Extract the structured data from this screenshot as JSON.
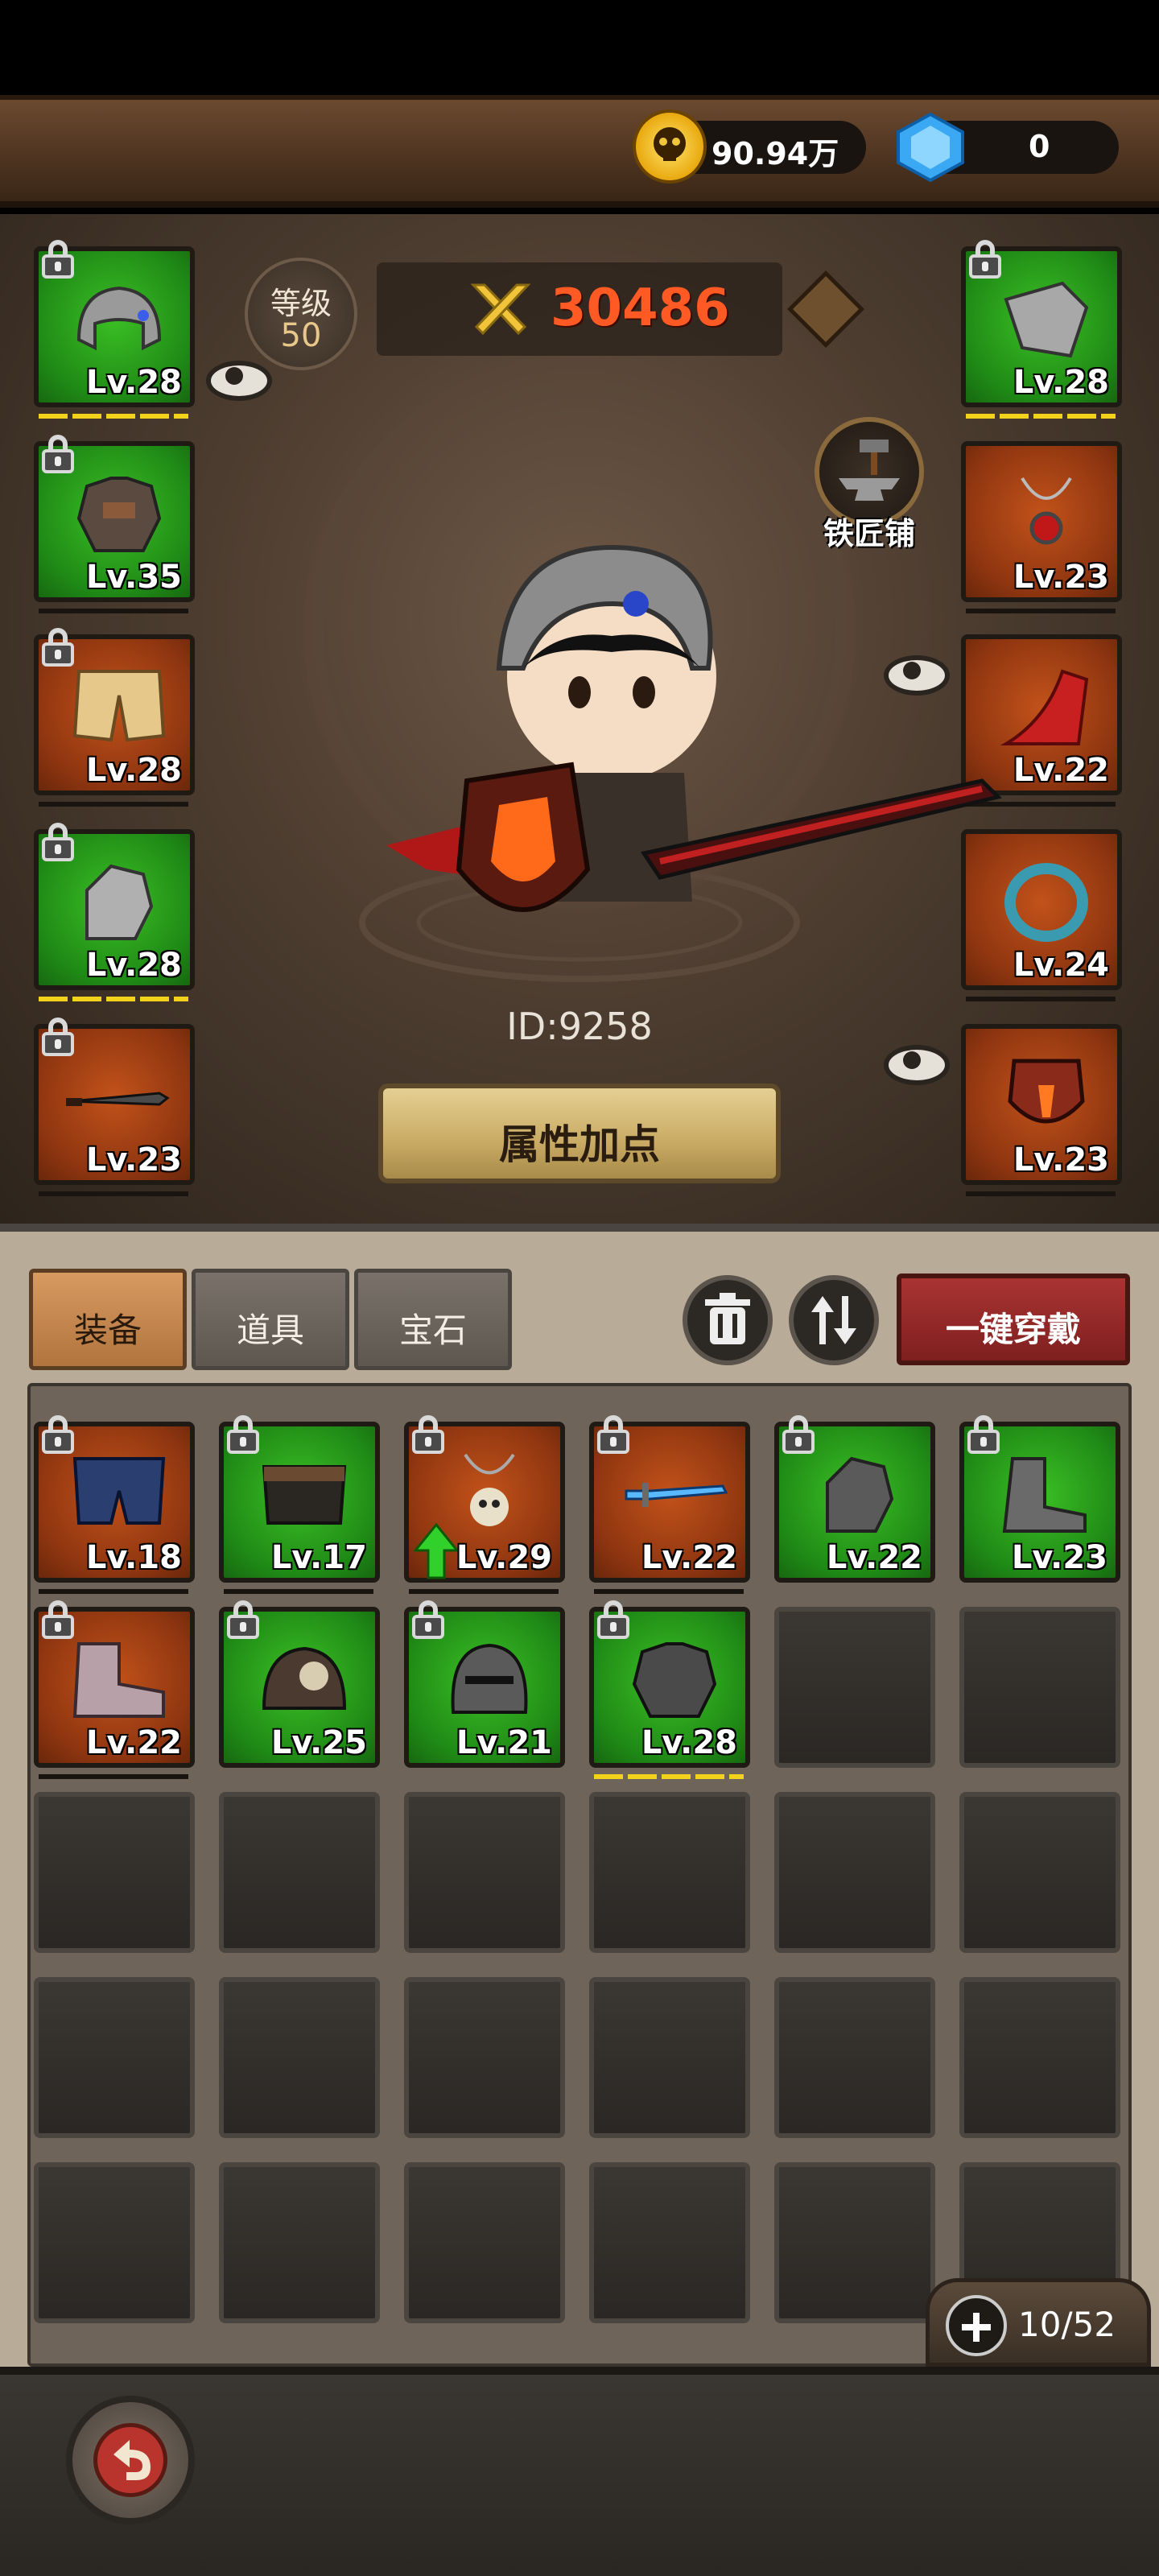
{
  "currency": {
    "gold": "90.94万",
    "gems": "0"
  },
  "hero": {
    "level_label": "等级",
    "level_value": "50",
    "power": "30486",
    "id_text": "ID:9258",
    "attr_button": "属性加点",
    "blacksmith_label": "铁匠铺"
  },
  "equipped_left": [
    {
      "slot": "helmet",
      "rarity": "green",
      "level": "Lv.28"
    },
    {
      "slot": "armor",
      "rarity": "green",
      "level": "Lv.35"
    },
    {
      "slot": "pants",
      "rarity": "orange",
      "level": "Lv.28"
    },
    {
      "slot": "gauntlets",
      "rarity": "green",
      "level": "Lv.28"
    },
    {
      "slot": "weapon",
      "rarity": "orange",
      "level": "Lv.23"
    }
  ],
  "equipped_right": [
    {
      "slot": "shoulder",
      "rarity": "green",
      "level": "Lv.28"
    },
    {
      "slot": "necklace",
      "rarity": "orange",
      "level": "Lv.23"
    },
    {
      "slot": "cape",
      "rarity": "orange",
      "level": "Lv.22"
    },
    {
      "slot": "ring",
      "rarity": "orange",
      "level": "Lv.24"
    },
    {
      "slot": "shield",
      "rarity": "orange",
      "level": "Lv.23"
    }
  ],
  "tabs": [
    {
      "label": "装备",
      "active": true
    },
    {
      "label": "道具",
      "active": false
    },
    {
      "label": "宝石",
      "active": false
    }
  ],
  "wear_all_button": "一键穿戴",
  "inventory": [
    {
      "item": "shorts",
      "rarity": "orange",
      "level": "Lv.18"
    },
    {
      "item": "belt",
      "rarity": "green",
      "level": "Lv.17"
    },
    {
      "item": "skull-necklace",
      "rarity": "orange",
      "level": "Lv.29",
      "upgrade": true
    },
    {
      "item": "ice-sword",
      "rarity": "orange",
      "level": "Lv.22"
    },
    {
      "item": "gauntlet",
      "rarity": "green",
      "level": "Lv.22"
    },
    {
      "item": "boots",
      "rarity": "green",
      "level": "Lv.23"
    },
    {
      "item": "boots",
      "rarity": "orange",
      "level": "Lv.22"
    },
    {
      "item": "helmet",
      "rarity": "green",
      "level": "Lv.25"
    },
    {
      "item": "helmet",
      "rarity": "green",
      "level": "Lv.21"
    },
    {
      "item": "armor",
      "rarity": "green",
      "level": "Lv.28"
    }
  ],
  "capacity": "10/52"
}
